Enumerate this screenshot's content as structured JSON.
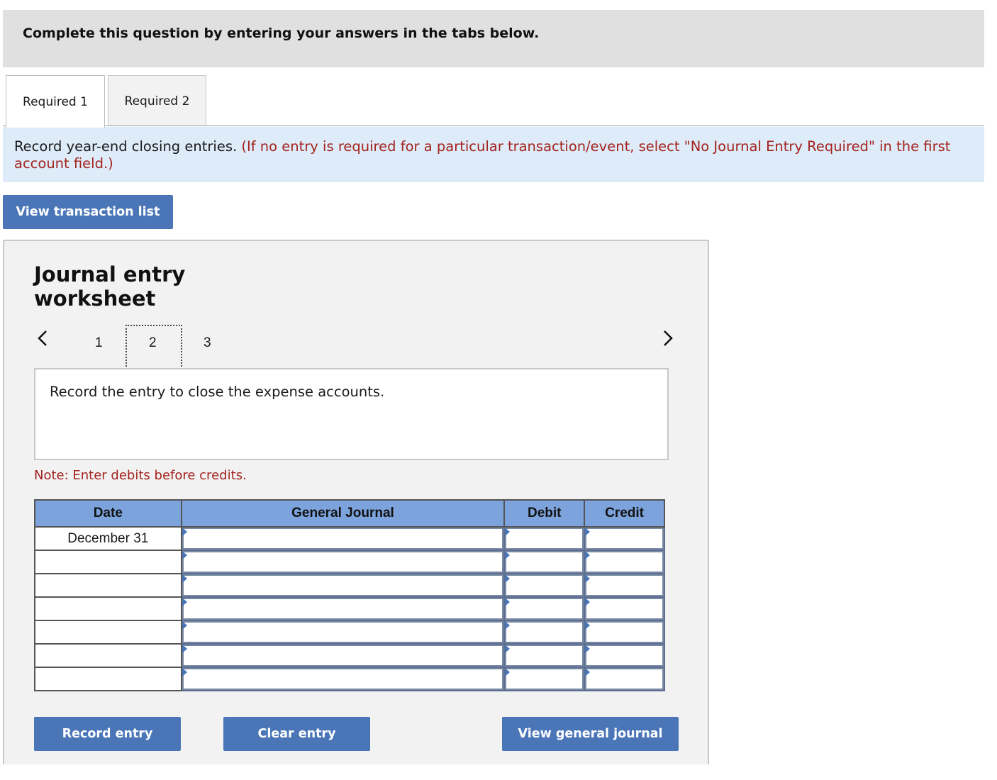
{
  "header": {
    "text": "Complete this question by entering your answers in the tabs below."
  },
  "tabs": [
    {
      "label": "Required 1",
      "active": true
    },
    {
      "label": "Required 2",
      "active": false
    }
  ],
  "instructions": {
    "main": "Record year-end closing entries. ",
    "note": "(If no entry is required for a particular transaction/event, select \"No Journal Entry Required\" in the first account field.)"
  },
  "view_transaction_list_label": "View transaction list",
  "worksheet": {
    "title": "Journal entry worksheet",
    "pages": [
      "1",
      "2",
      "3"
    ],
    "current_page": "2",
    "prev_icon": "chevron-left-icon",
    "next_icon": "chevron-right-icon",
    "description": "Record the entry to close the expense accounts.",
    "note": "Note: Enter debits before credits.",
    "table": {
      "headers": [
        "Date",
        "General Journal",
        "Debit",
        "Credit"
      ],
      "rows": [
        {
          "date": "December 31",
          "account": "",
          "debit": "",
          "credit": ""
        },
        {
          "date": "",
          "account": "",
          "debit": "",
          "credit": ""
        },
        {
          "date": "",
          "account": "",
          "debit": "",
          "credit": ""
        },
        {
          "date": "",
          "account": "",
          "debit": "",
          "credit": ""
        },
        {
          "date": "",
          "account": "",
          "debit": "",
          "credit": ""
        },
        {
          "date": "",
          "account": "",
          "debit": "",
          "credit": ""
        },
        {
          "date": "",
          "account": "",
          "debit": "",
          "credit": ""
        }
      ]
    },
    "buttons": {
      "record": "Record entry",
      "clear": "Clear entry",
      "view_journal": "View general journal"
    }
  },
  "colors": {
    "button_blue": "#4a76b8",
    "header_blue": "#7ca3dc",
    "instruction_bg": "#deebf8",
    "note_red": "#a3231f"
  }
}
